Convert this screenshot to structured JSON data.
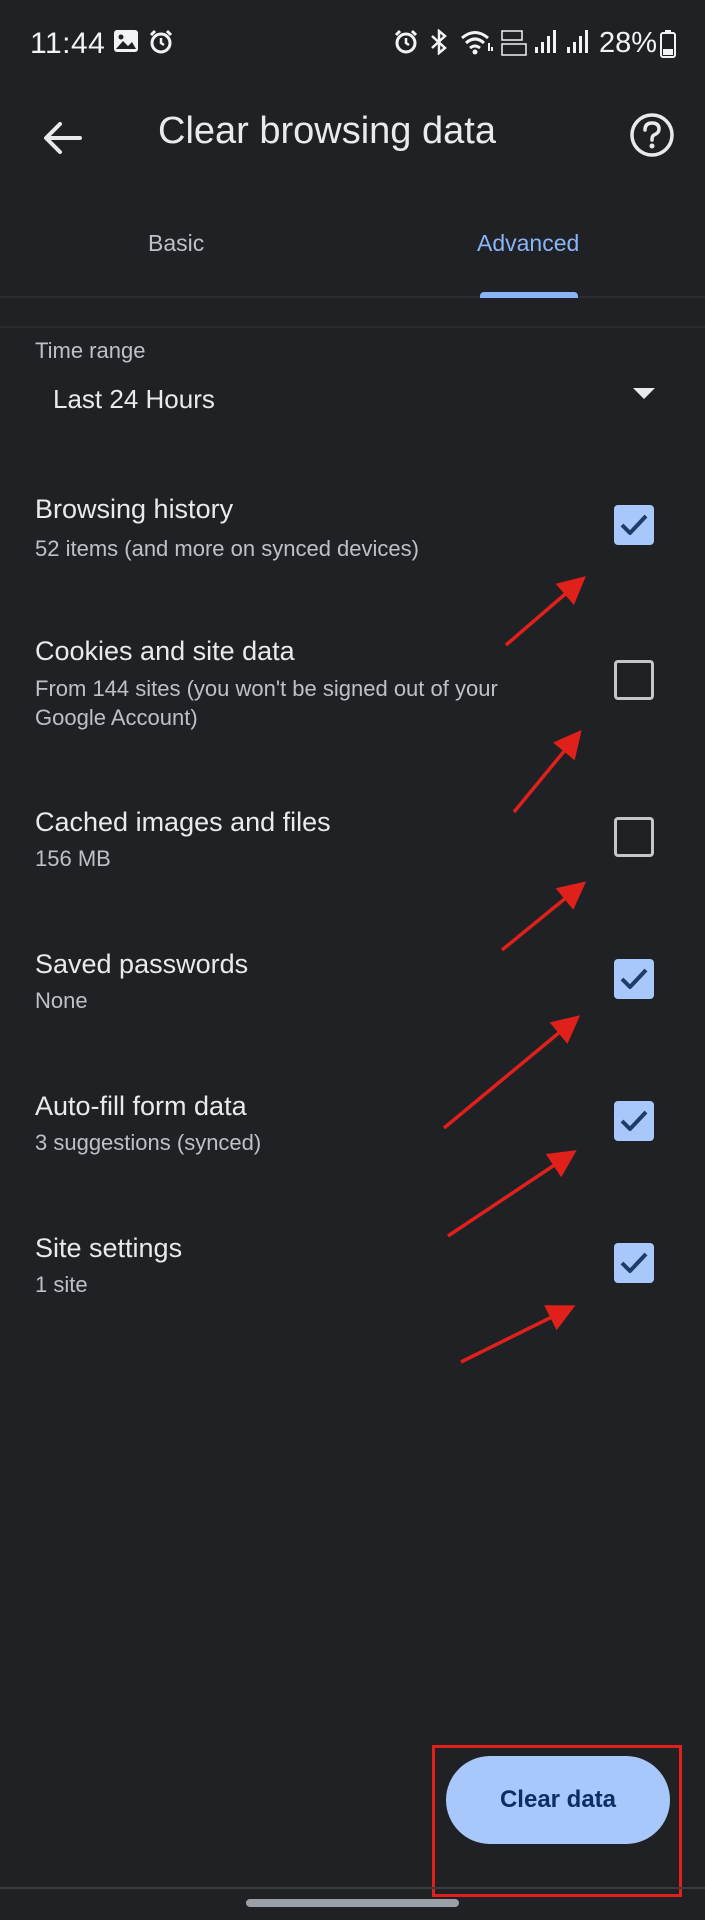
{
  "status_bar": {
    "time": "11:44",
    "battery": "28%"
  },
  "app_bar": {
    "title": "Clear browsing data"
  },
  "tabs": [
    {
      "label": "Basic",
      "selected": false
    },
    {
      "label": "Advanced",
      "selected": true
    }
  ],
  "time_range": {
    "label": "Time range",
    "value": "Last 24 Hours"
  },
  "items": [
    {
      "title": "Browsing history",
      "subtitle": "52 items (and more on synced devices)",
      "checked": true
    },
    {
      "title": "Cookies and site data",
      "subtitle": "From 144 sites (you won't be signed out of your Google Account)",
      "checked": false
    },
    {
      "title": "Cached images and files",
      "subtitle": "156 MB",
      "checked": false
    },
    {
      "title": "Saved passwords",
      "subtitle": "None",
      "checked": true
    },
    {
      "title": "Auto-fill form data",
      "subtitle": "3 suggestions (synced)",
      "checked": true
    },
    {
      "title": "Site settings",
      "subtitle": "1 site",
      "checked": true
    }
  ],
  "clear_button": {
    "label": "Clear data"
  },
  "colors": {
    "background": "#202124",
    "accent": "#8ab4f8",
    "checkbox_fill": "#a8c7fa",
    "annotation": "#e0201b"
  }
}
